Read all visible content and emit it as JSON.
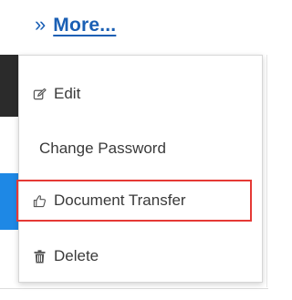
{
  "more_link": {
    "chevron": "»",
    "label": "More..."
  },
  "menu": {
    "items": [
      {
        "label": "Edit",
        "icon": "edit-icon"
      },
      {
        "label": "Change Password",
        "icon": ""
      },
      {
        "label": "Document Transfer",
        "icon": "thumbs-up-icon",
        "highlighted": true
      },
      {
        "label": "Delete",
        "icon": "trash-icon"
      }
    ]
  },
  "colors": {
    "link": "#1a5fb4",
    "highlight_border": "#e53935",
    "menu_text": "#3a3a3a",
    "dark_sliver": "#2b2b2b",
    "blue_sliver": "#1e88e5"
  }
}
